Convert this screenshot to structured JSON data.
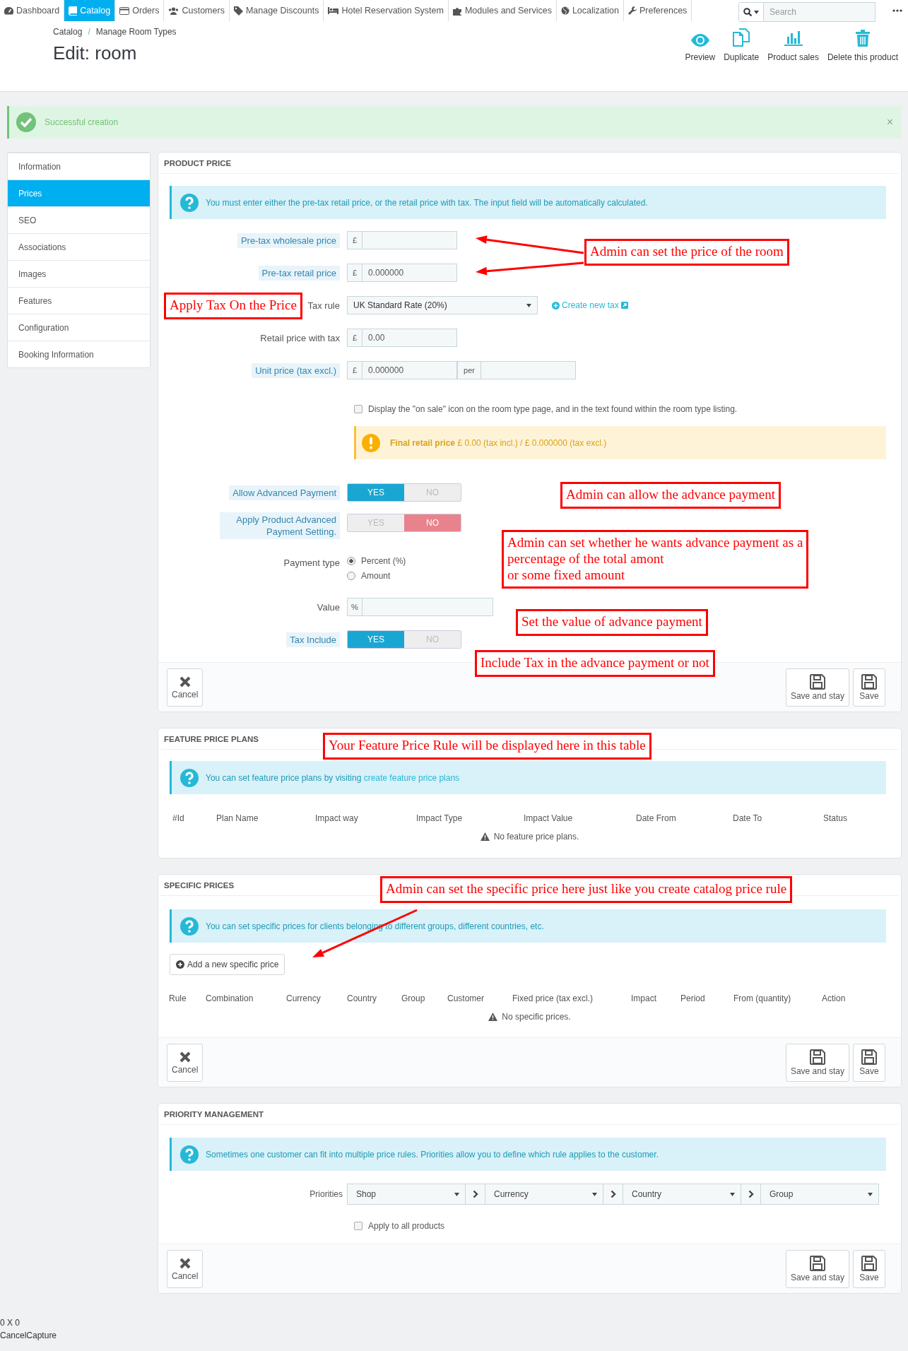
{
  "nav": {
    "items": [
      {
        "label": "Dashboard",
        "selected": false
      },
      {
        "label": "Catalog",
        "selected": true
      },
      {
        "label": "Orders",
        "selected": false
      },
      {
        "label": "Customers",
        "selected": false
      },
      {
        "label": "Manage Discounts",
        "selected": false
      },
      {
        "label": "Hotel Reservation System",
        "selected": false
      },
      {
        "label": "Modules and Services",
        "selected": false
      },
      {
        "label": "Localization",
        "selected": false
      },
      {
        "label": "Preferences",
        "selected": false
      }
    ],
    "search": {
      "placeholder": "Search"
    }
  },
  "breadcrumb": {
    "items": [
      "Catalog",
      "Manage Room Types"
    ],
    "separator": "/"
  },
  "title": "Edit: room",
  "toolbar": [
    "Preview",
    "Duplicate",
    "Product sales",
    "Delete this product"
  ],
  "alert": {
    "text": "Successful creation",
    "close": "×"
  },
  "sidebar": {
    "items": [
      {
        "label": "Information",
        "selected": false
      },
      {
        "label": "Prices",
        "selected": true
      },
      {
        "label": "SEO",
        "selected": false
      },
      {
        "label": "Associations",
        "selected": false
      },
      {
        "label": "Images",
        "selected": false
      },
      {
        "label": "Features",
        "selected": false
      },
      {
        "label": "Configuration",
        "selected": false
      },
      {
        "label": "Booking Information",
        "selected": false
      }
    ]
  },
  "product_price": {
    "title": "PRODUCT PRICE",
    "info": "You must enter either the pre-tax retail price, or the retail price with tax. The input field will be automatically calculated.",
    "fields": [
      {
        "kind": "money",
        "label": "Pre-tax wholesale price",
        "help": true,
        "prefix": "£"
      },
      {
        "kind": "money",
        "label": "Pre-tax retail price",
        "help": true,
        "prefix": "£",
        "value": "0.000000"
      },
      {
        "kind": "select",
        "label": "Tax rule",
        "help": false,
        "value": "UK Standard Rate (20%)",
        "link": "Create new tax"
      },
      {
        "kind": "money",
        "label": "Retail price with tax",
        "help": false,
        "prefix": "£",
        "value": "0.00"
      },
      {
        "kind": "unit",
        "label": "Unit price (tax excl.)",
        "help": true,
        "prefix": "£",
        "value": "0.000000",
        "unit_label": "per"
      },
      {
        "kind": "checkbox",
        "label": "Display the \"on sale\" icon on the room type page, and in the text found within the room type listing.",
        "checked": false
      },
      {
        "kind": "warning",
        "text": "**Final retail price** £ 0.00 (tax incl.) / £ 0.000000 (tax excl.)"
      },
      {
        "kind": "switch",
        "label": "Allow Advanced Payment",
        "help": true,
        "options": [
          {
            "label": "YES",
            "selected": true
          },
          {
            "label": "NO",
            "selected": false
          }
        ]
      },
      {
        "kind": "switch",
        "label": "Apply Product Advanced Payment Setting.",
        "help": true,
        "options": [
          {
            "label": "YES",
            "selected": false
          },
          {
            "label": "NO",
            "selected": true
          }
        ]
      },
      {
        "kind": "radio",
        "label": "Payment type",
        "help": false,
        "options": [
          {
            "label": "Percent (%)",
            "selected": true
          },
          {
            "label": "Amount",
            "selected": false
          }
        ]
      },
      {
        "kind": "money",
        "label": "Value",
        "help": false,
        "prefix": "%"
      },
      {
        "kind": "switch",
        "label": "Tax Include",
        "help": true,
        "options": [
          {
            "label": "YES",
            "selected": true
          },
          {
            "label": "NO",
            "selected": false
          }
        ]
      }
    ],
    "footer": {
      "cancel": "Cancel",
      "save_stay": "Save and stay",
      "save": "Save"
    }
  },
  "feature_price_plans": {
    "title": "FEATURE PRICE PLANS",
    "info": "You can set feature price plans by visiting",
    "info_link": "create feature price plans",
    "columns": [
      "#Id",
      "Plan Name",
      "Impact way",
      "Impact Type",
      "Impact Value",
      "Date From",
      "Date To",
      "Status"
    ],
    "empty": "No feature price plans."
  },
  "specific_prices": {
    "title": "SPECIFIC PRICES",
    "info": "You can set specific prices for clients belonging to different groups, different countries, etc.",
    "add_button": "Add a new specific price",
    "columns": [
      "Rule",
      "Combination",
      "Currency",
      "Country",
      "Group",
      "Customer",
      "Fixed price (tax excl.)",
      "Impact",
      "Period",
      "From (quantity)",
      "Action"
    ],
    "empty": "No specific prices.",
    "footer": {
      "cancel": "Cancel",
      "save_stay": "Save and stay",
      "save": "Save"
    }
  },
  "priority_management": {
    "title": "PRIORITY MANAGEMENT",
    "info": "Sometimes one customer can fit into multiple price rules. Priorities allow you to define which rule applies to the customer.",
    "label": "Priorities",
    "priorities": [
      "Shop",
      "Currency",
      "Country",
      "Group"
    ],
    "apply_all": {
      "label": "Apply to all products",
      "checked": false
    },
    "footer": {
      "cancel": "Cancel",
      "save_stay": "Save and stay",
      "save": "Save"
    }
  },
  "bottom_text": [
    "0 X 0",
    "CancelCapture"
  ],
  "annotations": [
    {
      "text": "Admin can set the price of the room"
    },
    {
      "text": "Apply Tax On the Price"
    },
    {
      "text": "Admin can allow the advance payment"
    },
    {
      "text": "Admin can set whether he wants advance payment as a\npercentage of the total amont\nor some fixed amount"
    },
    {
      "text": "Set the value of advance payment"
    },
    {
      "text": "Include Tax in the advance payment or not"
    },
    {
      "text": "Your Feature Price Rule will be displayed here in this table"
    },
    {
      "text": "Admin can set the specific price here just like you create catalog price rule"
    }
  ]
}
